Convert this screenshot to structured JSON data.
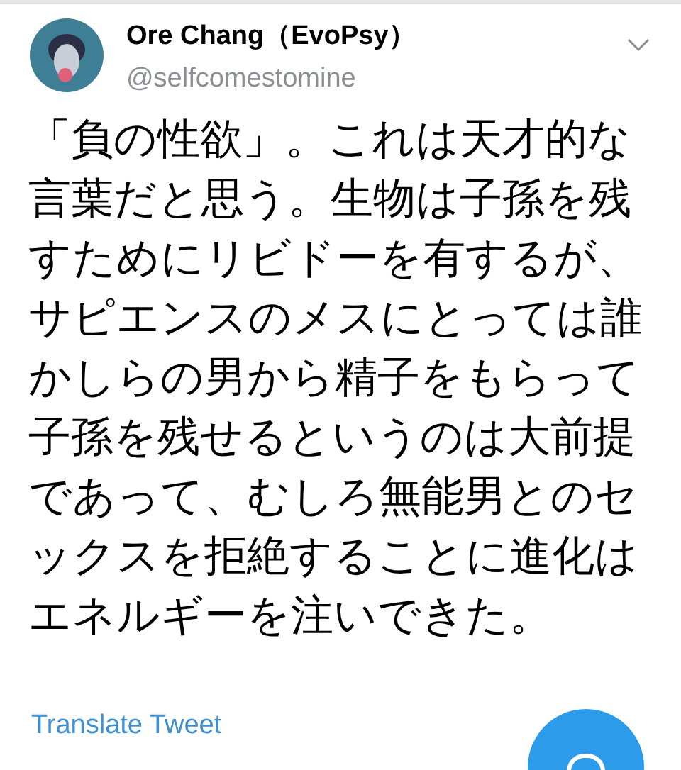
{
  "tweet": {
    "name": "Ore Chang（EvoPsy）",
    "handle": "@selfcomestomine",
    "body_lines": [
      "「負の性欲」。これは天才的な",
      "言葉だと思う。生物は子孫を残",
      "すためにリビドーを有するが、",
      "サピエンスのメスにとっては誰",
      "かしらの男から精子をもらって",
      "子孫を残せるというのは大前提",
      "であって、むしろ無能男とのセ",
      "ックスを拒絶することに進化は",
      "エネルギーを注いできた。"
    ],
    "translate": "Translate Tweet"
  }
}
